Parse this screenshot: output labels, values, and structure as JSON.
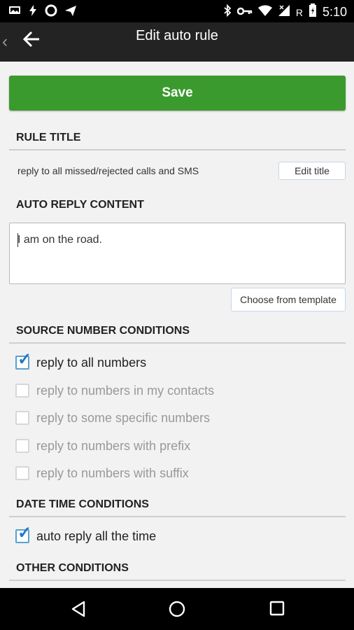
{
  "status_bar": {
    "time": "5:10",
    "left_icons": [
      "cast-icon",
      "flash-icon",
      "sync-icon",
      "send-icon"
    ],
    "right_icons": [
      "bluetooth-icon",
      "key-icon",
      "wifi-icon",
      "signal-icon",
      "roaming-indicator",
      "battery-icon"
    ],
    "roaming_label": "R"
  },
  "app_bar": {
    "title": "Edit auto rule"
  },
  "save_button": {
    "label": "Save",
    "color": "#3b9a2d"
  },
  "rule_title_section": {
    "header": "RULE TITLE",
    "value": "reply to all missed/rejected calls and SMS",
    "edit_label": "Edit title"
  },
  "reply_content_section": {
    "header": "AUTO REPLY CONTENT",
    "text": "I am on the road.",
    "template_label": "Choose from template"
  },
  "source_number_section": {
    "header": "SOURCE NUMBER CONDITIONS",
    "options": [
      {
        "label": "reply to all numbers",
        "checked": true,
        "enabled": true
      },
      {
        "label": "reply to numbers in my contacts",
        "checked": false,
        "enabled": false
      },
      {
        "label": "reply to some specific numbers",
        "checked": false,
        "enabled": false
      },
      {
        "label": "reply to numbers with prefix",
        "checked": false,
        "enabled": false
      },
      {
        "label": "reply to numbers with suffix",
        "checked": false,
        "enabled": false
      }
    ]
  },
  "date_time_section": {
    "header": "DATE TIME CONDITIONS",
    "options": [
      {
        "label": "auto reply all the time",
        "checked": true,
        "enabled": true
      }
    ]
  },
  "other_section": {
    "header": "OTHER CONDITIONS"
  },
  "nav_bar": {
    "buttons": [
      "back-triangle-icon",
      "home-circle-icon",
      "recents-square-icon"
    ]
  }
}
